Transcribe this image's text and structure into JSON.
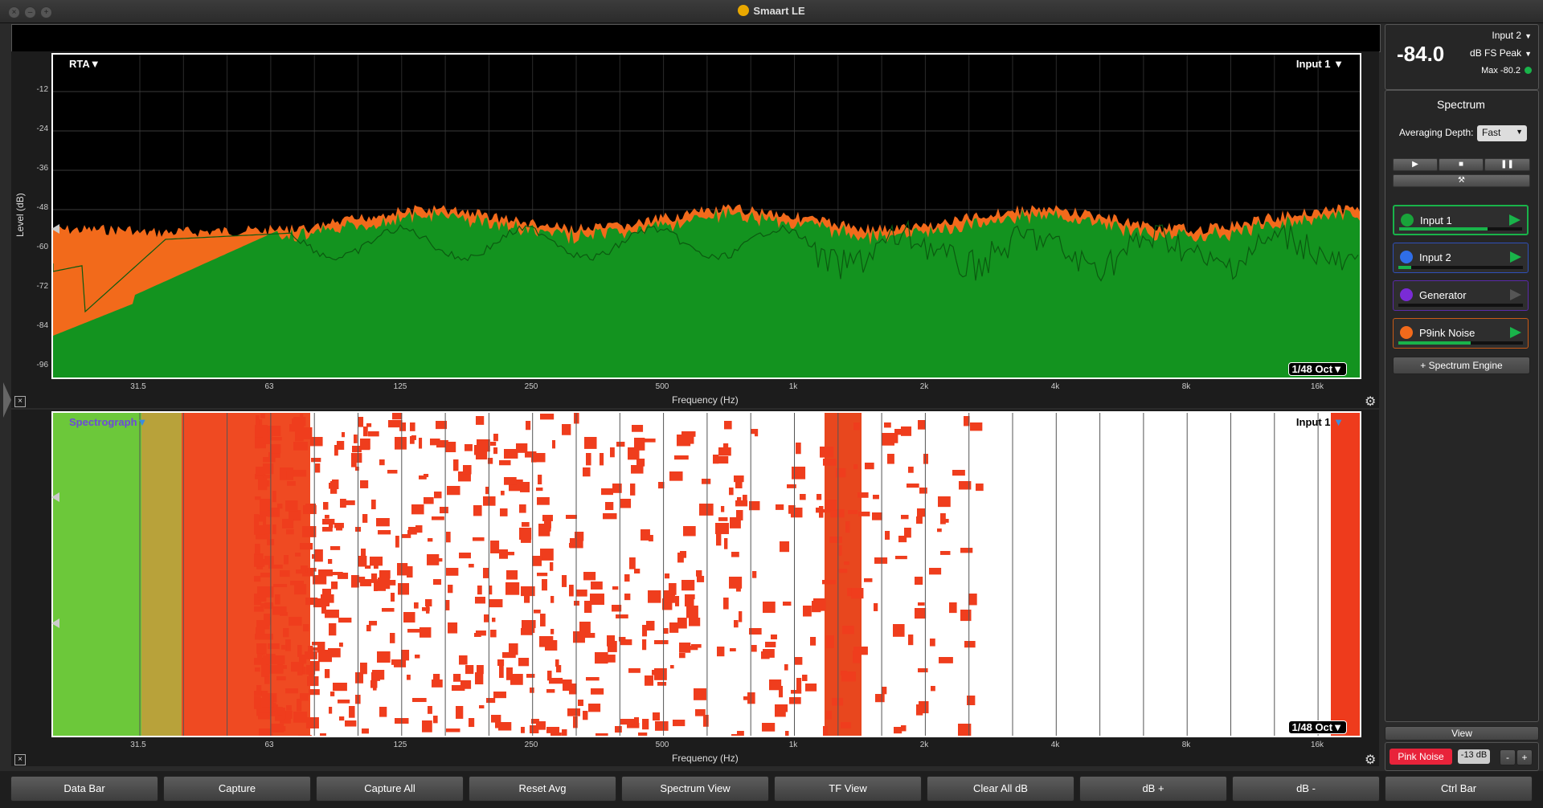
{
  "window": {
    "title": "Smaart LE"
  },
  "rta": {
    "label": "RTA",
    "input_label": "Input 1",
    "resolution": "1/48 Oct",
    "y_title": "Level (dB)",
    "x_title": "Frequency (Hz)",
    "y_ticks": [
      "-12",
      "-24",
      "-36",
      "-48",
      "-60",
      "-72",
      "-84",
      "-96"
    ],
    "x_ticks": [
      "31.5",
      "63",
      "125",
      "250",
      "500",
      "1k",
      "2k",
      "4k",
      "8k",
      "16k"
    ]
  },
  "spectrograph": {
    "label": "Spectrograph",
    "input_label": "Input 1",
    "resolution": "1/48 Oct",
    "x_title": "Frequency (Hz)",
    "x_ticks": [
      "31.5",
      "63",
      "125",
      "250",
      "500",
      "1k",
      "2k",
      "4k",
      "8k",
      "16k"
    ]
  },
  "meter": {
    "value": "-84.0",
    "input": "Input 2",
    "mode": "dB FS Peak",
    "max": "Max -80.2"
  },
  "spectrum": {
    "title": "Spectrum",
    "averaging_label": "Averaging Depth:",
    "averaging_value": "Fast",
    "add_engine": "+ Spectrum Engine",
    "channels": [
      {
        "name": "Input 1",
        "color": "#19a33a",
        "active": true,
        "level": 0.72
      },
      {
        "name": "Input 2",
        "color": "#2f6ee8",
        "active": true,
        "level": 0.1
      },
      {
        "name": "Generator",
        "color": "#7a2bd6",
        "active": false,
        "level": 0.0
      },
      {
        "name": "P9ink Noise",
        "color": "#f26a1b",
        "active": true,
        "level": 0.58
      }
    ]
  },
  "view": {
    "label": "View",
    "pink_noise": "Pink Noise",
    "gain": "-13 dB",
    "minus": "-",
    "plus": "+"
  },
  "bottom_buttons": [
    "Data Bar",
    "Capture",
    "Capture All",
    "Reset Avg",
    "Spectrum View",
    "TF View",
    "Clear All dB",
    "dB +",
    "dB -",
    "Ctrl Bar"
  ]
}
